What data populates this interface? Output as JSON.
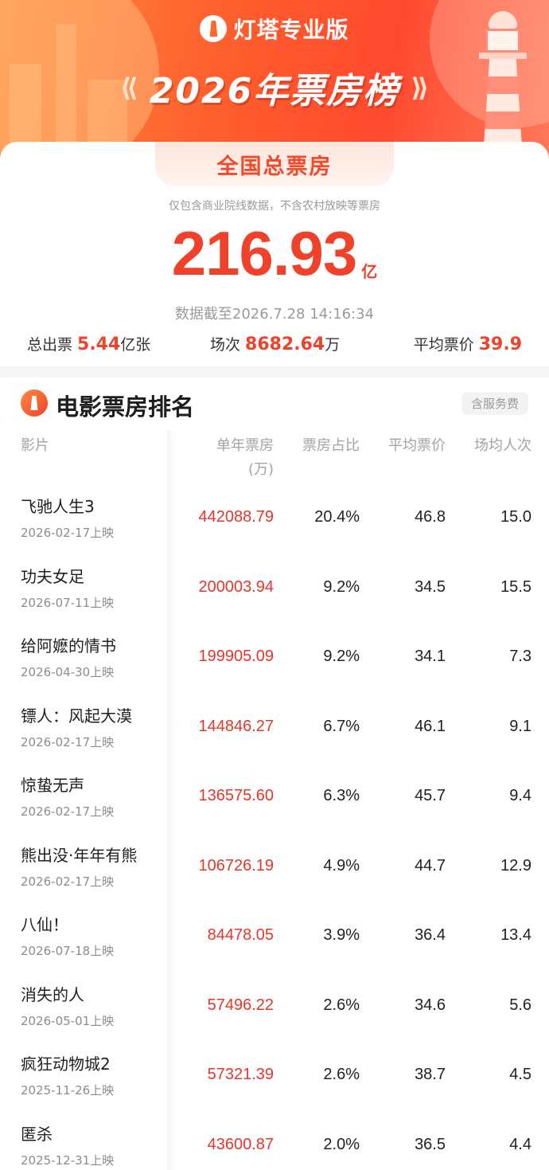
{
  "header": {
    "brand": "灯塔专业版",
    "title": "2026年票房榜",
    "brand_icon": "lighthouse-icon"
  },
  "summary": {
    "tab_label": "全国总票房",
    "note": "仅包含商业院线数据，不含农村放映等票房",
    "total_value": "216.93",
    "total_unit": "亿",
    "timestamp": "数据截至2026.7.28 14:16:34",
    "tickets_label": "总出票",
    "tickets_value": "5.44",
    "tickets_unit": "亿张",
    "shows_label": "场次",
    "shows_value": "8682.64",
    "shows_unit": "万",
    "avg_price_label": "平均票价",
    "avg_price_value": "39.9"
  },
  "ranking": {
    "title": "电影票房排名",
    "fee_badge": "含服务费",
    "columns": {
      "film": "影片",
      "box_office": "单年票房",
      "box_office_unit": "(万)",
      "share": "票房占比",
      "avg_price": "平均票价",
      "avg_audience": "场均人次"
    },
    "rows": [
      {
        "name": "飞驰人生3",
        "date": "2026-02-17上映",
        "box_office": "442088.79",
        "share": "20.4%",
        "avg_price": "46.8",
        "avg_audience": "15.0"
      },
      {
        "name": "功夫女足",
        "date": "2026-07-11上映",
        "box_office": "200003.94",
        "share": "9.2%",
        "avg_price": "34.5",
        "avg_audience": "15.5"
      },
      {
        "name": "给阿嬷的情书",
        "date": "2026-04-30上映",
        "box_office": "199905.09",
        "share": "9.2%",
        "avg_price": "34.1",
        "avg_audience": "7.3"
      },
      {
        "name": "镖人：风起大漠",
        "date": "2026-02-17上映",
        "box_office": "144846.27",
        "share": "6.7%",
        "avg_price": "46.1",
        "avg_audience": "9.1"
      },
      {
        "name": "惊蛰无声",
        "date": "2026-02-17上映",
        "box_office": "136575.60",
        "share": "6.3%",
        "avg_price": "45.7",
        "avg_audience": "9.4"
      },
      {
        "name": "熊出没·年年有熊",
        "date": "2026-02-17上映",
        "box_office": "106726.19",
        "share": "4.9%",
        "avg_price": "44.7",
        "avg_audience": "12.9"
      },
      {
        "name": "八仙！",
        "date": "2026-07-18上映",
        "box_office": "84478.05",
        "share": "3.9%",
        "avg_price": "36.4",
        "avg_audience": "13.4"
      },
      {
        "name": "消失的人",
        "date": "2026-05-01上映",
        "box_office": "57496.22",
        "share": "2.6%",
        "avg_price": "34.6",
        "avg_audience": "5.6"
      },
      {
        "name": "疯狂动物城2",
        "date": "2025-11-26上映",
        "box_office": "57321.39",
        "share": "2.6%",
        "avg_price": "38.7",
        "avg_audience": "4.5"
      },
      {
        "name": "匿杀",
        "date": "2025-12-31上映",
        "box_office": "43600.87",
        "share": "2.0%",
        "avg_price": "36.5",
        "avg_audience": "4.4"
      }
    ]
  },
  "colors": {
    "accent": "#f0412a",
    "box_office_red": "#e8352a",
    "header_orange": "#ff6a2c"
  }
}
